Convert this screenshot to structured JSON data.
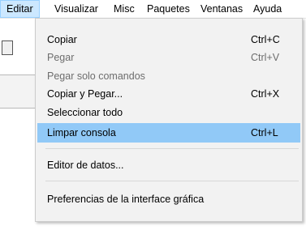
{
  "menubar": {
    "items": [
      {
        "label": "Editar",
        "active": true
      },
      {
        "label": "Visualizar"
      },
      {
        "label": "Misc"
      },
      {
        "label": "Paquetes"
      },
      {
        "label": "Ventanas"
      },
      {
        "label": "Ayuda"
      }
    ]
  },
  "edit_menu": {
    "items": [
      {
        "label": "Copiar",
        "shortcut": "Ctrl+C",
        "enabled": true
      },
      {
        "label": "Pegar",
        "shortcut": "Ctrl+V",
        "enabled": false
      },
      {
        "label": "Pegar solo comandos",
        "shortcut": "",
        "enabled": false
      },
      {
        "label": "Copiar y Pegar...",
        "shortcut": "Ctrl+X",
        "enabled": true
      },
      {
        "label": "Seleccionar todo",
        "shortcut": "",
        "enabled": true
      },
      {
        "label": "Limpar consola",
        "shortcut": "Ctrl+L",
        "enabled": true,
        "highlighted": true
      },
      {
        "label": "Editor de datos...",
        "shortcut": "",
        "enabled": true
      },
      {
        "label": "Preferencias de la interface gráfica",
        "shortcut": "",
        "enabled": true
      }
    ]
  },
  "colors": {
    "menubar_active_bg": "#cce8ff",
    "highlight_bg": "#91c9f7",
    "menu_bg": "#f2f2f2",
    "disabled_text": "#6d6d6d"
  }
}
